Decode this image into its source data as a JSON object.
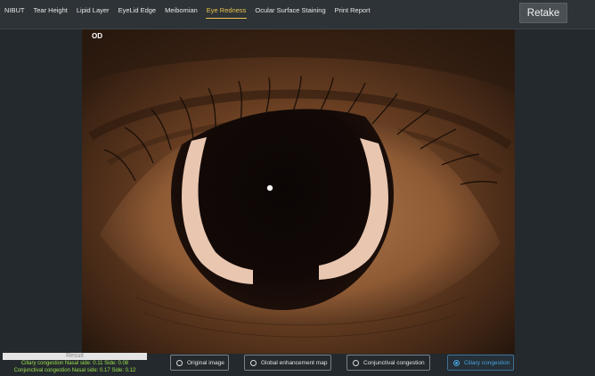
{
  "nav": {
    "tabs": [
      {
        "label": "NIBUT"
      },
      {
        "label": "Tear Height"
      },
      {
        "label": "Lipid Layer"
      },
      {
        "label": "EyeLid Edge"
      },
      {
        "label": "Meibomian"
      },
      {
        "label": "Eye Redness"
      },
      {
        "label": "Ocular Surface Staining"
      },
      {
        "label": "Print Report"
      }
    ],
    "active_tab": "Eye Redness",
    "retake_label": "Retake"
  },
  "viewer": {
    "eye_label": "OD"
  },
  "result": {
    "title": "Result",
    "lines": [
      "Ciliary congestion Nasal side: 0.11 Side: 0.08",
      "Conjunctival congestion Nasal side: 0.17 Side: 0.12"
    ]
  },
  "modes": {
    "options": [
      {
        "label": "Original image"
      },
      {
        "label": "Global enhancement map"
      },
      {
        "label": "Conjunctival congestion"
      },
      {
        "label": "Ciliary congestion"
      }
    ],
    "selected": "Ciliary congestion"
  },
  "colors": {
    "active_tab": "#e9c14c",
    "result_text": "#9be04d",
    "selected_mode": "#4aa3df"
  }
}
